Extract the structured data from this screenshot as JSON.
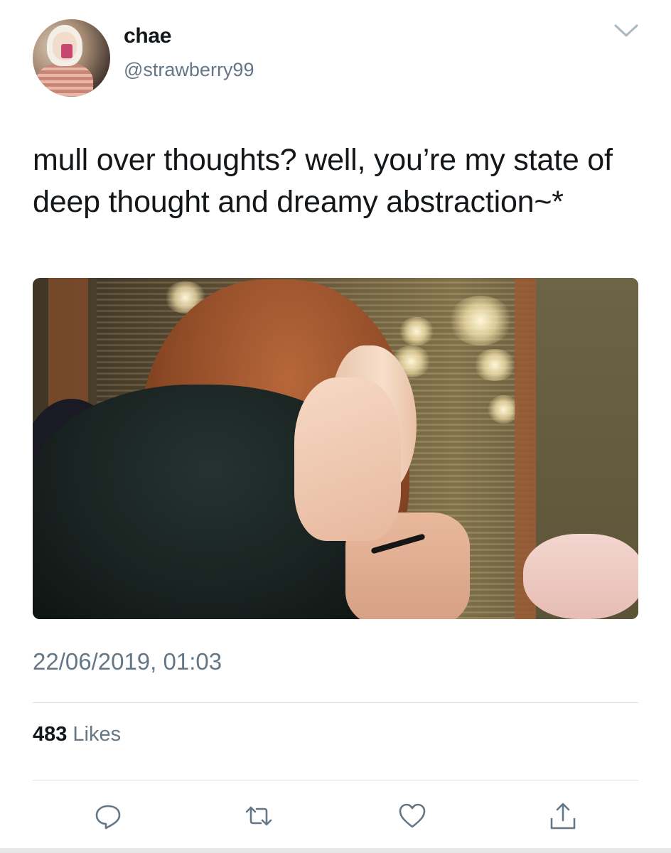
{
  "tweet": {
    "author": {
      "display_name": "chae",
      "handle": "@strawberry99"
    },
    "text": "mull over thoughts? well, you’re my state of deep thought and dreamy abstraction~*",
    "timestamp": "22/06/2019, 01:03",
    "likes": {
      "count": "483",
      "label": "Likes"
    },
    "actions": [
      {
        "name": "reply",
        "icon": "speech-bubble-icon"
      },
      {
        "name": "retweet",
        "icon": "retweet-icon"
      },
      {
        "name": "like",
        "icon": "heart-icon"
      },
      {
        "name": "share",
        "icon": "share-icon"
      }
    ]
  },
  "colors": {
    "text_primary": "#14171a",
    "text_secondary": "#657786",
    "divider": "#dbe0e4",
    "icon": "#657786"
  }
}
